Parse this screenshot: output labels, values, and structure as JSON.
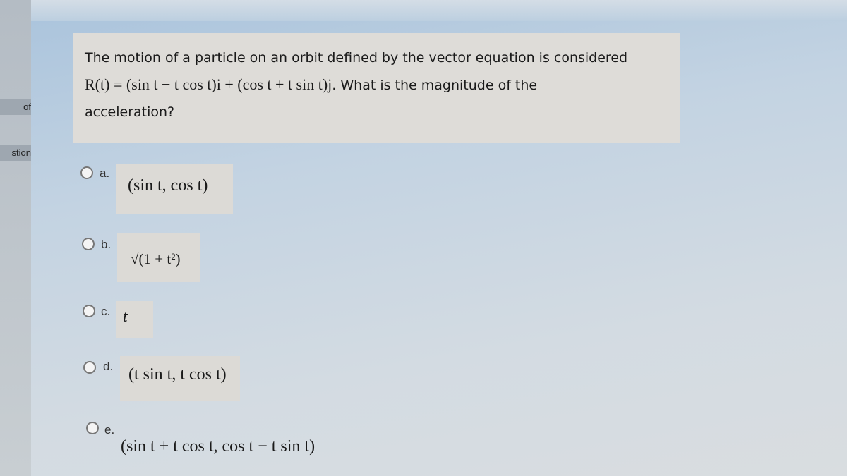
{
  "sidebar": {
    "tabs": [
      {
        "label": "of"
      },
      {
        "label": "stion"
      }
    ]
  },
  "question": {
    "line1": "The motion of a particle on an orbit defined by the vector equation is considered",
    "equation": "R(t) = (sin t − t cos t)i + (cos t + t sin t)j",
    "line2_rest": ". What is the magnitude of the",
    "line3": "acceleration?"
  },
  "options": [
    {
      "letter": "a.",
      "value": "(sin t, cos t)"
    },
    {
      "letter": "b.",
      "value": "√(1 + t²)"
    },
    {
      "letter": "c.",
      "value": "t"
    },
    {
      "letter": "d.",
      "value": "(t sin t, t cos t)"
    },
    {
      "letter": "e.",
      "value": "(sin t + t cos t, cos t − t sin t)"
    }
  ]
}
